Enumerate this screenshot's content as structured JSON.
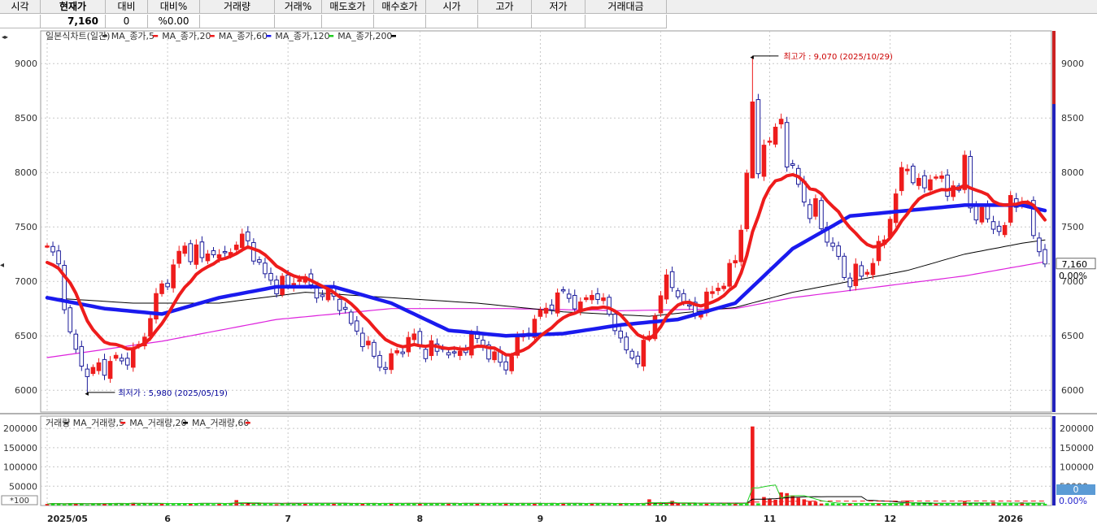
{
  "quote_table": {
    "headers": [
      "시각",
      "현재가",
      "대비",
      "대비%",
      "거래량",
      "거래%",
      "매도호가",
      "매수호가",
      "시가",
      "고가",
      "저가",
      "거래대금"
    ],
    "values": [
      "",
      "7,160",
      "0",
      "%0.00",
      "",
      "",
      "",
      "",
      "",
      "",
      "",
      ""
    ]
  },
  "chart_data": [
    {
      "type": "candlestick",
      "legend": [
        {
          "name": "일본식차트(일간)",
          "color": "#333333"
        },
        {
          "name": "MA_종가,5",
          "color": "#ee1c1c"
        },
        {
          "name": "MA_종가,20",
          "color": "#ee1c1c"
        },
        {
          "name": "MA_종가,60",
          "color": "#1a1aee"
        },
        {
          "name": "MA_종가,120",
          "color": "#22cc22"
        },
        {
          "name": "MA_종가,200",
          "color": "#000000"
        }
      ],
      "ylim": [
        5800,
        9300
      ],
      "yticks": [
        6000,
        6500,
        7000,
        7500,
        8000,
        8500,
        9000
      ],
      "x_tick_labels": [
        {
          "label": "2025/05",
          "index": 0
        },
        {
          "label": "6",
          "index": 21
        },
        {
          "label": "7",
          "index": 42
        },
        {
          "label": "8",
          "index": 65
        },
        {
          "label": "9",
          "index": 86
        },
        {
          "label": "10",
          "index": 107
        },
        {
          "label": "11",
          "index": 126
        },
        {
          "label": "12",
          "index": 147
        },
        {
          "label": "2026",
          "index": 168
        }
      ],
      "n_days": 175,
      "close_anchors": [
        [
          0,
          7300
        ],
        [
          1,
          7250
        ],
        [
          2,
          7150
        ],
        [
          3,
          6800
        ],
        [
          4,
          6500
        ],
        [
          5,
          6350
        ],
        [
          6,
          6250
        ],
        [
          7,
          6150
        ],
        [
          8,
          6180
        ],
        [
          9,
          6220
        ],
        [
          10,
          6200
        ],
        [
          11,
          6250
        ],
        [
          12,
          6300
        ],
        [
          13,
          6250
        ],
        [
          14,
          6300
        ],
        [
          15,
          6350
        ],
        [
          16,
          6400
        ],
        [
          17,
          6500
        ],
        [
          18,
          6700
        ],
        [
          19,
          6850
        ],
        [
          20,
          6950
        ],
        [
          21,
          7000
        ],
        [
          22,
          7150
        ],
        [
          23,
          7250
        ],
        [
          24,
          7300
        ],
        [
          25,
          7250
        ],
        [
          26,
          7300
        ],
        [
          27,
          7200
        ],
        [
          28,
          7250
        ],
        [
          29,
          7300
        ],
        [
          30,
          7200
        ],
        [
          31,
          7250
        ],
        [
          32,
          7300
        ],
        [
          33,
          7350
        ],
        [
          34,
          7400
        ],
        [
          35,
          7350
        ],
        [
          36,
          7250
        ],
        [
          37,
          7150
        ],
        [
          38,
          7050
        ],
        [
          39,
          7000
        ],
        [
          40,
          6950
        ],
        [
          41,
          7000
        ],
        [
          42,
          6950
        ],
        [
          43,
          7000
        ],
        [
          44,
          7050
        ],
        [
          45,
          7000
        ],
        [
          46,
          6950
        ],
        [
          47,
          6900
        ],
        [
          48,
          6850
        ],
        [
          49,
          6900
        ],
        [
          50,
          6850
        ],
        [
          51,
          6800
        ],
        [
          52,
          6700
        ],
        [
          53,
          6600
        ],
        [
          54,
          6550
        ],
        [
          55,
          6450
        ],
        [
          56,
          6400
        ],
        [
          57,
          6300
        ],
        [
          58,
          6250
        ],
        [
          59,
          6200
        ],
        [
          60,
          6300
        ],
        [
          61,
          6350
        ],
        [
          62,
          6400
        ],
        [
          63,
          6450
        ],
        [
          64,
          6500
        ],
        [
          65,
          6400
        ],
        [
          66,
          6350
        ],
        [
          67,
          6400
        ],
        [
          68,
          6350
        ],
        [
          69,
          6400
        ],
        [
          70,
          6350
        ],
        [
          71,
          6300
        ],
        [
          72,
          6350
        ],
        [
          73,
          6400
        ],
        [
          74,
          6500
        ],
        [
          75,
          6450
        ],
        [
          76,
          6400
        ],
        [
          77,
          6350
        ],
        [
          78,
          6300
        ],
        [
          79,
          6250
        ],
        [
          80,
          6200
        ],
        [
          81,
          6350
        ],
        [
          82,
          6450
        ],
        [
          83,
          6500
        ],
        [
          84,
          6550
        ],
        [
          85,
          6650
        ],
        [
          86,
          6700
        ],
        [
          87,
          6750
        ],
        [
          88,
          6800
        ],
        [
          89,
          6850
        ],
        [
          90,
          6900
        ],
        [
          91,
          6850
        ],
        [
          92,
          6800
        ],
        [
          93,
          6750
        ],
        [
          94,
          6850
        ],
        [
          95,
          6900
        ],
        [
          96,
          6850
        ],
        [
          97,
          6800
        ],
        [
          98,
          6700
        ],
        [
          99,
          6600
        ],
        [
          100,
          6450
        ],
        [
          101,
          6350
        ],
        [
          102,
          6300
        ],
        [
          103,
          6300
        ],
        [
          104,
          6400
        ],
        [
          105,
          6500
        ],
        [
          106,
          6700
        ],
        [
          107,
          6900
        ],
        [
          108,
          7000
        ],
        [
          109,
          6950
        ],
        [
          110,
          6900
        ],
        [
          111,
          6800
        ],
        [
          112,
          6750
        ],
        [
          113,
          6700
        ],
        [
          114,
          6750
        ],
        [
          115,
          6850
        ],
        [
          116,
          6900
        ],
        [
          117,
          6950
        ],
        [
          118,
          7000
        ],
        [
          119,
          7100
        ],
        [
          120,
          7200
        ],
        [
          121,
          7500
        ],
        [
          122,
          8000
        ],
        [
          123,
          8600
        ],
        [
          124,
          8000
        ],
        [
          125,
          8300
        ],
        [
          126,
          8250
        ],
        [
          127,
          8400
        ],
        [
          128,
          8500
        ],
        [
          129,
          8100
        ],
        [
          130,
          8000
        ],
        [
          131,
          7900
        ],
        [
          132,
          7750
        ],
        [
          133,
          7600
        ],
        [
          134,
          7700
        ],
        [
          135,
          7500
        ],
        [
          136,
          7400
        ],
        [
          137,
          7300
        ],
        [
          138,
          7200
        ],
        [
          139,
          7050
        ],
        [
          140,
          7000
        ],
        [
          141,
          7100
        ],
        [
          142,
          7050
        ],
        [
          143,
          7100
        ],
        [
          144,
          7200
        ],
        [
          145,
          7300
        ],
        [
          146,
          7400
        ],
        [
          147,
          7600
        ],
        [
          148,
          7800
        ],
        [
          149,
          8000
        ],
        [
          150,
          8050
        ],
        [
          151,
          7950
        ],
        [
          152,
          7900
        ],
        [
          153,
          7850
        ],
        [
          154,
          7950
        ],
        [
          155,
          8000
        ],
        [
          156,
          7900
        ],
        [
          157,
          7800
        ],
        [
          158,
          7900
        ],
        [
          159,
          7850
        ],
        [
          160,
          8100
        ],
        [
          161,
          7700
        ],
        [
          162,
          7600
        ],
        [
          163,
          7650
        ],
        [
          164,
          7550
        ],
        [
          165,
          7500
        ],
        [
          166,
          7500
        ],
        [
          167,
          7450
        ],
        [
          168,
          7800
        ],
        [
          169,
          7700
        ],
        [
          170,
          7750
        ],
        [
          171,
          7650
        ],
        [
          172,
          7450
        ],
        [
          173,
          7300
        ],
        [
          174,
          7160
        ]
      ],
      "ma20_anchors": [
        [
          0,
          7050
        ],
        [
          5,
          6950
        ],
        [
          10,
          6650
        ],
        [
          15,
          6450
        ],
        [
          20,
          6550
        ],
        [
          25,
          6850
        ],
        [
          30,
          7150
        ],
        [
          35,
          7300
        ],
        [
          40,
          7200
        ],
        [
          45,
          7050
        ],
        [
          50,
          6900
        ],
        [
          55,
          6750
        ],
        [
          60,
          6550
        ],
        [
          65,
          6400
        ],
        [
          70,
          6400
        ],
        [
          75,
          6400
        ],
        [
          80,
          6350
        ],
        [
          85,
          6400
        ],
        [
          90,
          6550
        ],
        [
          95,
          6700
        ],
        [
          100,
          6700
        ],
        [
          105,
          6550
        ],
        [
          110,
          6700
        ],
        [
          115,
          6800
        ],
        [
          120,
          6900
        ],
        [
          125,
          7500
        ],
        [
          130,
          7750
        ],
        [
          135,
          7900
        ],
        [
          140,
          7750
        ],
        [
          145,
          7450
        ],
        [
          150,
          7500
        ],
        [
          155,
          7750
        ],
        [
          160,
          7850
        ],
        [
          165,
          7850
        ],
        [
          170,
          7800
        ],
        [
          174,
          7650
        ]
      ],
      "ma60_anchors": [
        [
          0,
          6850
        ],
        [
          10,
          6750
        ],
        [
          20,
          6700
        ],
        [
          30,
          6850
        ],
        [
          40,
          6950
        ],
        [
          50,
          6950
        ],
        [
          60,
          6800
        ],
        [
          70,
          6550
        ],
        [
          80,
          6500
        ],
        [
          90,
          6520
        ],
        [
          100,
          6600
        ],
        [
          110,
          6650
        ],
        [
          120,
          6800
        ],
        [
          130,
          7300
        ],
        [
          140,
          7600
        ],
        [
          150,
          7650
        ],
        [
          160,
          7700
        ],
        [
          170,
          7700
        ],
        [
          174,
          7650
        ]
      ],
      "ma120_anchors": [
        [
          0,
          6850
        ],
        [
          15,
          6800
        ],
        [
          30,
          6800
        ],
        [
          45,
          6900
        ],
        [
          60,
          6850
        ],
        [
          75,
          6800
        ],
        [
          90,
          6720
        ],
        [
          105,
          6680
        ],
        [
          120,
          6760
        ],
        [
          130,
          6900
        ],
        [
          140,
          7000
        ],
        [
          150,
          7100
        ],
        [
          160,
          7250
        ],
        [
          170,
          7350
        ],
        [
          174,
          7380
        ]
      ],
      "ma200_anchors": [
        [
          0,
          6300
        ],
        [
          20,
          6450
        ],
        [
          40,
          6650
        ],
        [
          60,
          6750
        ],
        [
          80,
          6750
        ],
        [
          100,
          6730
        ],
        [
          120,
          6750
        ],
        [
          130,
          6850
        ],
        [
          145,
          6950
        ],
        [
          160,
          7050
        ],
        [
          174,
          7180
        ]
      ],
      "annotations": [
        {
          "text": "최고가 : 9,070 (2025/10/29)",
          "index": 123,
          "value": 9070,
          "color": "#cc0000"
        },
        {
          "text": "최저가 : 5,980 (2025/05/19)",
          "index": 7,
          "value": 5980,
          "color": "#000099"
        }
      ],
      "current_price": {
        "label": "7,160",
        "value": 7160,
        "pct": "0.00%"
      }
    },
    {
      "type": "bar",
      "legend": [
        {
          "name": "거래량",
          "color": "#333333"
        },
        {
          "name": "MA_거래량,5",
          "color": "#ee1c1c"
        },
        {
          "name": "MA_거래량,20",
          "color": "#000000"
        },
        {
          "name": "MA_거래량,60",
          "color": "#ee1c1c"
        }
      ],
      "ylim": [
        0,
        215000
      ],
      "yticks": [
        50000,
        100000,
        150000,
        200000
      ],
      "scale_label": "*100",
      "spikes": [
        [
          0,
          4000
        ],
        [
          3,
          3000
        ],
        [
          7,
          2500
        ],
        [
          15,
          7000
        ],
        [
          22,
          4000
        ],
        [
          33,
          14000
        ],
        [
          40,
          3000
        ],
        [
          60,
          4500
        ],
        [
          100,
          5000
        ],
        [
          105,
          16000
        ],
        [
          109,
          12000
        ],
        [
          117,
          3500
        ],
        [
          123,
          205000
        ],
        [
          125,
          22000
        ],
        [
          126,
          18000
        ],
        [
          127,
          15000
        ],
        [
          128,
          34000
        ],
        [
          129,
          32000
        ],
        [
          130,
          26000
        ],
        [
          131,
          20000
        ],
        [
          132,
          16000
        ],
        [
          133,
          12000
        ],
        [
          134,
          10000
        ],
        [
          150,
          13000
        ],
        [
          160,
          12000
        ],
        [
          165,
          9000
        ],
        [
          170,
          8000
        ],
        [
          172,
          6000
        ]
      ],
      "current_volume": {
        "label": "0",
        "pct": "0.00%"
      }
    }
  ]
}
